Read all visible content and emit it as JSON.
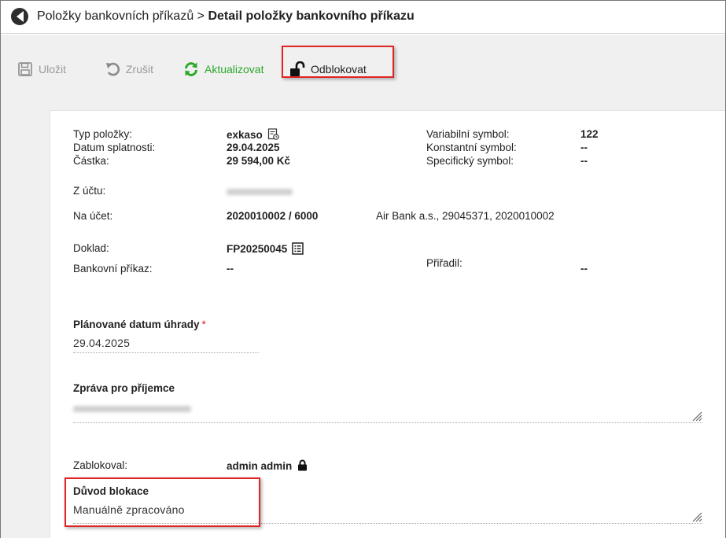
{
  "breadcrumb": {
    "parent": "Položky bankovních příkazů",
    "separator": ">",
    "current": "Detail položky bankovního příkazu"
  },
  "toolbar": {
    "save": "Uložit",
    "cancel": "Zrušit",
    "refresh": "Aktualizovat",
    "unlock": "Odblokovat"
  },
  "details": {
    "typ_label": "Typ položky:",
    "typ_value": "exkaso",
    "datum_label": "Datum splatnosti:",
    "datum_value": "29.04.2025",
    "castka_label": "Částka:",
    "castka_value": "29 594,00 Kč",
    "vs_label": "Variabilní symbol:",
    "vs_value": "122",
    "ks_label": "Konstantní symbol:",
    "ks_value": "--",
    "ss_label": "Specifický symbol:",
    "ss_value": "--",
    "z_uctu_label": "Z účtu:",
    "na_ucet_label": "Na účet:",
    "na_ucet_value": "2020010002 / 6000",
    "na_ucet_info": "Air Bank a.s., 29045371, 2020010002",
    "doklad_label": "Doklad:",
    "doklad_value": "FP20250045",
    "prikaz_label": "Bankovní příkaz:",
    "prikaz_value": "--",
    "priradil_label": "Přiřadil:",
    "priradil_value": "--"
  },
  "form": {
    "planned_label": "Plánované datum úhrady",
    "planned_required": "*",
    "planned_value": "29.04.2025",
    "message_label": "Zpráva pro příjemce",
    "blocked_by_label": "Zablokoval:",
    "blocked_by_value": "admin admin",
    "reason_label": "Důvod blokace",
    "reason_value": "Manuálně zpracováno"
  },
  "colors": {
    "accent_green": "#2aa82a",
    "highlight_red": "#e02424",
    "toolbar_bg": "#f0f0f0"
  },
  "icons": [
    "logo-icon",
    "save-icon",
    "undo-icon",
    "refresh-icon",
    "unlock-icon",
    "document-icon",
    "list-document-icon",
    "lock-icon",
    "resize-handle-icon"
  ]
}
